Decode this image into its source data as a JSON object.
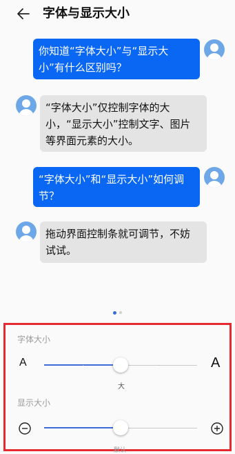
{
  "header": {
    "title": "字体与显示大小",
    "back_icon": "back-arrow-icon"
  },
  "messages": [
    {
      "side": "right",
      "text": "你知道“字体大小”与“显示大\n小”有什么区别吗？"
    },
    {
      "side": "left",
      "text": "“字体大小”仅控制字体的大\n小，“显示大小”控制文字、图片\n等界面元素的大小。"
    },
    {
      "side": "right",
      "text": "“字体大小”和“显示大小”如何调\n节？"
    },
    {
      "side": "left",
      "text": "拖动界面控制条就可调节，不妨\n试试。"
    }
  ],
  "pager": {
    "pages": 2,
    "active": 1
  },
  "font_size": {
    "label": "字体大小",
    "small_glyph": "A",
    "large_glyph": "A",
    "current_label": "大",
    "level_fraction": 0.5
  },
  "display_size": {
    "label": "显示大小",
    "current_label": "默认",
    "level_fraction": 0.5,
    "decrease_icon": "minus-circle-icon",
    "increase_icon": "plus-circle-icon"
  },
  "colors": {
    "accent": "#0a67f3",
    "slider": "#3c6bd8",
    "highlight_border": "#e8282f"
  }
}
